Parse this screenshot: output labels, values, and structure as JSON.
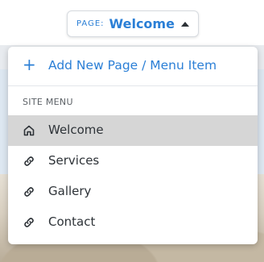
{
  "page_selector": {
    "label": "PAGE:",
    "value": "Welcome"
  },
  "dropdown": {
    "add_label": "Add New Page / Menu Item",
    "section_label": "SITE MENU",
    "items": [
      {
        "label": "Welcome",
        "icon": "home-icon",
        "active": true
      },
      {
        "label": "Services",
        "icon": "link-icon",
        "active": false
      },
      {
        "label": "Gallery",
        "icon": "link-icon",
        "active": false
      },
      {
        "label": "Contact",
        "icon": "link-icon",
        "active": false
      }
    ]
  },
  "colors": {
    "accent": "#2b7fd6",
    "active_row": "#d6d6d6",
    "text": "#2e3338"
  }
}
